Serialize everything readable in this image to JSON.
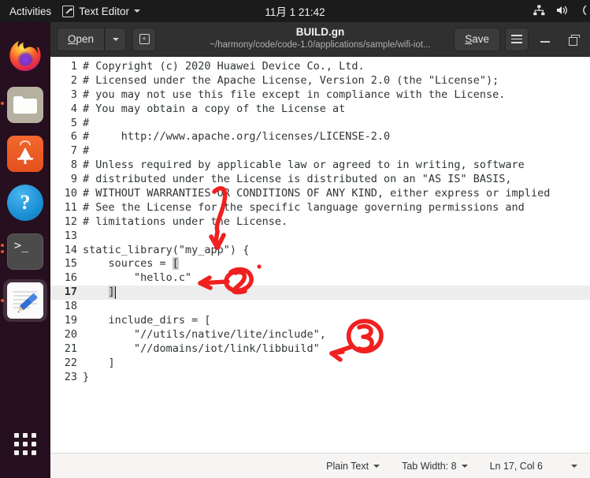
{
  "topbar": {
    "activities": "Activities",
    "app_name": "Text Editor",
    "app_icon": "text-editor-icon",
    "clock": "11月 1  21:42",
    "icons": [
      "network-icon",
      "volume-icon",
      "power-icon"
    ]
  },
  "dock": {
    "items": [
      {
        "name": "firefox",
        "label": "Firefox",
        "running": false,
        "active": false
      },
      {
        "name": "files",
        "label": "Files",
        "running": true,
        "active": false
      },
      {
        "name": "ubuntu-software",
        "label": "Ubuntu Software",
        "running": false,
        "active": false
      },
      {
        "name": "help",
        "label": "Help",
        "running": false,
        "active": false
      },
      {
        "name": "terminal",
        "label": "Terminal",
        "running": true,
        "active": false
      },
      {
        "name": "text-editor",
        "label": "Text Editor",
        "running": true,
        "active": true
      }
    ],
    "show_applications": "Show Applications"
  },
  "window": {
    "open_label": "Open",
    "open_mnemonic": "O",
    "new_tab_label": "+",
    "title": "BUILD.gn",
    "subtitle": "~/harmony/code/code-1.0/applications/sample/wifi-iot...",
    "save_label": "Save",
    "save_mnemonic": "S",
    "menu_label": "Main Menu",
    "minimize_label": "Minimize",
    "maximize_label": "Restore"
  },
  "editor": {
    "current_line": 17,
    "lines": [
      {
        "n": 1,
        "text": "# Copyright (c) 2020 Huawei Device Co., Ltd."
      },
      {
        "n": 2,
        "text": "# Licensed under the Apache License, Version 2.0 (the \"License\");"
      },
      {
        "n": 3,
        "text": "# you may not use this file except in compliance with the License."
      },
      {
        "n": 4,
        "text": "# You may obtain a copy of the License at"
      },
      {
        "n": 5,
        "text": "#"
      },
      {
        "n": 6,
        "text": "#     http://www.apache.org/licenses/LICENSE-2.0"
      },
      {
        "n": 7,
        "text": "#"
      },
      {
        "n": 8,
        "text": "# Unless required by applicable law or agreed to in writing, software"
      },
      {
        "n": 9,
        "text": "# distributed under the License is distributed on an \"AS IS\" BASIS,"
      },
      {
        "n": 10,
        "text": "# WITHOUT WARRANTIES OR CONDITIONS OF ANY KIND, either express or implied"
      },
      {
        "n": 11,
        "text": "# See the License for the specific language governing permissions and"
      },
      {
        "n": 12,
        "text": "# limitations under the License."
      },
      {
        "n": 13,
        "text": ""
      },
      {
        "n": 14,
        "text": "static_library(\"my_app\") {"
      },
      {
        "n": 15,
        "text": "    sources = [",
        "bracket": "["
      },
      {
        "n": 16,
        "text": "        \"hello.c\""
      },
      {
        "n": 17,
        "text": "    ]",
        "bracket": "]"
      },
      {
        "n": 18,
        "text": ""
      },
      {
        "n": 19,
        "text": "    include_dirs = ["
      },
      {
        "n": 20,
        "text": "        \"//utils/native/lite/include\","
      },
      {
        "n": 21,
        "text": "        \"//domains/iot/link/libbuild\""
      },
      {
        "n": 22,
        "text": "    ]"
      },
      {
        "n": 23,
        "text": "}"
      }
    ]
  },
  "statusbar": {
    "language": "Plain Text",
    "tab_width": "Tab Width: 8",
    "position": "Ln 17, Col 6"
  },
  "annotations": {
    "color": "#f02020",
    "marks": [
      {
        "label": "1",
        "target": "static_library line",
        "shape": "digit-with-down-arrow"
      },
      {
        "label": "2",
        "target": "hello.c source entry",
        "shape": "circled-digit-with-left-arrow"
      },
      {
        "label": "3",
        "target": "include_dirs entries",
        "shape": "circled-digit-with-left-arrow"
      }
    ]
  }
}
